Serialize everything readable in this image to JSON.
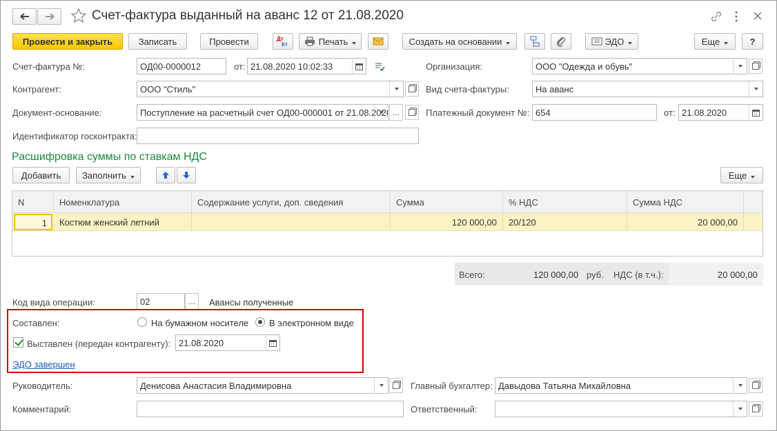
{
  "window": {
    "title": "Счет-фактура выданный на аванс 12 от 21.08.2020"
  },
  "toolbar": {
    "post_close": "Провести и закрыть",
    "save": "Записать",
    "post": "Провести",
    "print": "Печать",
    "create_based_on": "Создать на основании",
    "edo": "ЭДО",
    "more": "Еще",
    "help": "?"
  },
  "form": {
    "invoice_no_label": "Счет-фактура №:",
    "invoice_no": "ОД00-0000012",
    "from_label": "от:",
    "invoice_date": "21.08.2020 10:02:33",
    "org_label": "Организация:",
    "org": "ООО \"Одежда и обувь\"",
    "counterparty_label": "Контрагент:",
    "counterparty": "ООО \"Стиль\"",
    "invoice_type_label": "Вид счета-фактуры:",
    "invoice_type": "На аванс",
    "basis_label": "Документ-основание:",
    "basis": "Поступление на расчетный счет ОД00-000001 от 21.08.2020",
    "payment_doc_label": "Платежный документ №:",
    "payment_doc": "654",
    "payment_from_label": "от:",
    "payment_date": "21.08.2020",
    "gov_contract_label": "Идентификатор госконтракта:",
    "gov_contract": ""
  },
  "vat_section": {
    "title": "Расшифровка суммы по ставкам НДС",
    "add": "Добавить",
    "fill": "Заполнить",
    "more": "Еще",
    "columns": [
      "N",
      "Номенклатура",
      "Содержание услуги, доп. сведения",
      "Сумма",
      "% НДС",
      "Сумма НДС"
    ],
    "rows": [
      {
        "n": "1",
        "item": "Костюм женский летний",
        "content": "",
        "sum": "120 000,00",
        "vat_rate": "20/120",
        "vat_sum": "20 000,00"
      }
    ],
    "totals": {
      "total_label": "Всего:",
      "total": "120 000,00",
      "currency": "руб.",
      "vat_label": "НДС (в т.ч.):",
      "vat": "20 000,00"
    }
  },
  "operation": {
    "code_label": "Код вида операции:",
    "code": "02",
    "code_desc": "Авансы полученные"
  },
  "composed": {
    "label": "Составлен:",
    "option_paper": "На бумажном носителе",
    "option_electronic": "В электронном виде",
    "selected": "electronic",
    "issued_label": "Выставлен (передан контрагенту):",
    "issued_checked": true,
    "issued_date": "21.08.2020",
    "edo_link": "ЭДО завершен"
  },
  "signatures": {
    "head_label": "Руководитель:",
    "head": "Денисова Анастасия Владимировна",
    "chief_acc_label": "Главный бухгалтер:",
    "chief_acc": "Давыдова Татьяна Михайловна",
    "comment_label": "Комментарий:",
    "comment": "",
    "responsible_label": "Ответственный:",
    "responsible": ""
  },
  "colors": {
    "primary_button": "#f7c800",
    "section_title": "#1a8a3c",
    "selected_row": "#fbf3c5",
    "highlight_border": "#d40000",
    "link": "#1f5bb5"
  }
}
